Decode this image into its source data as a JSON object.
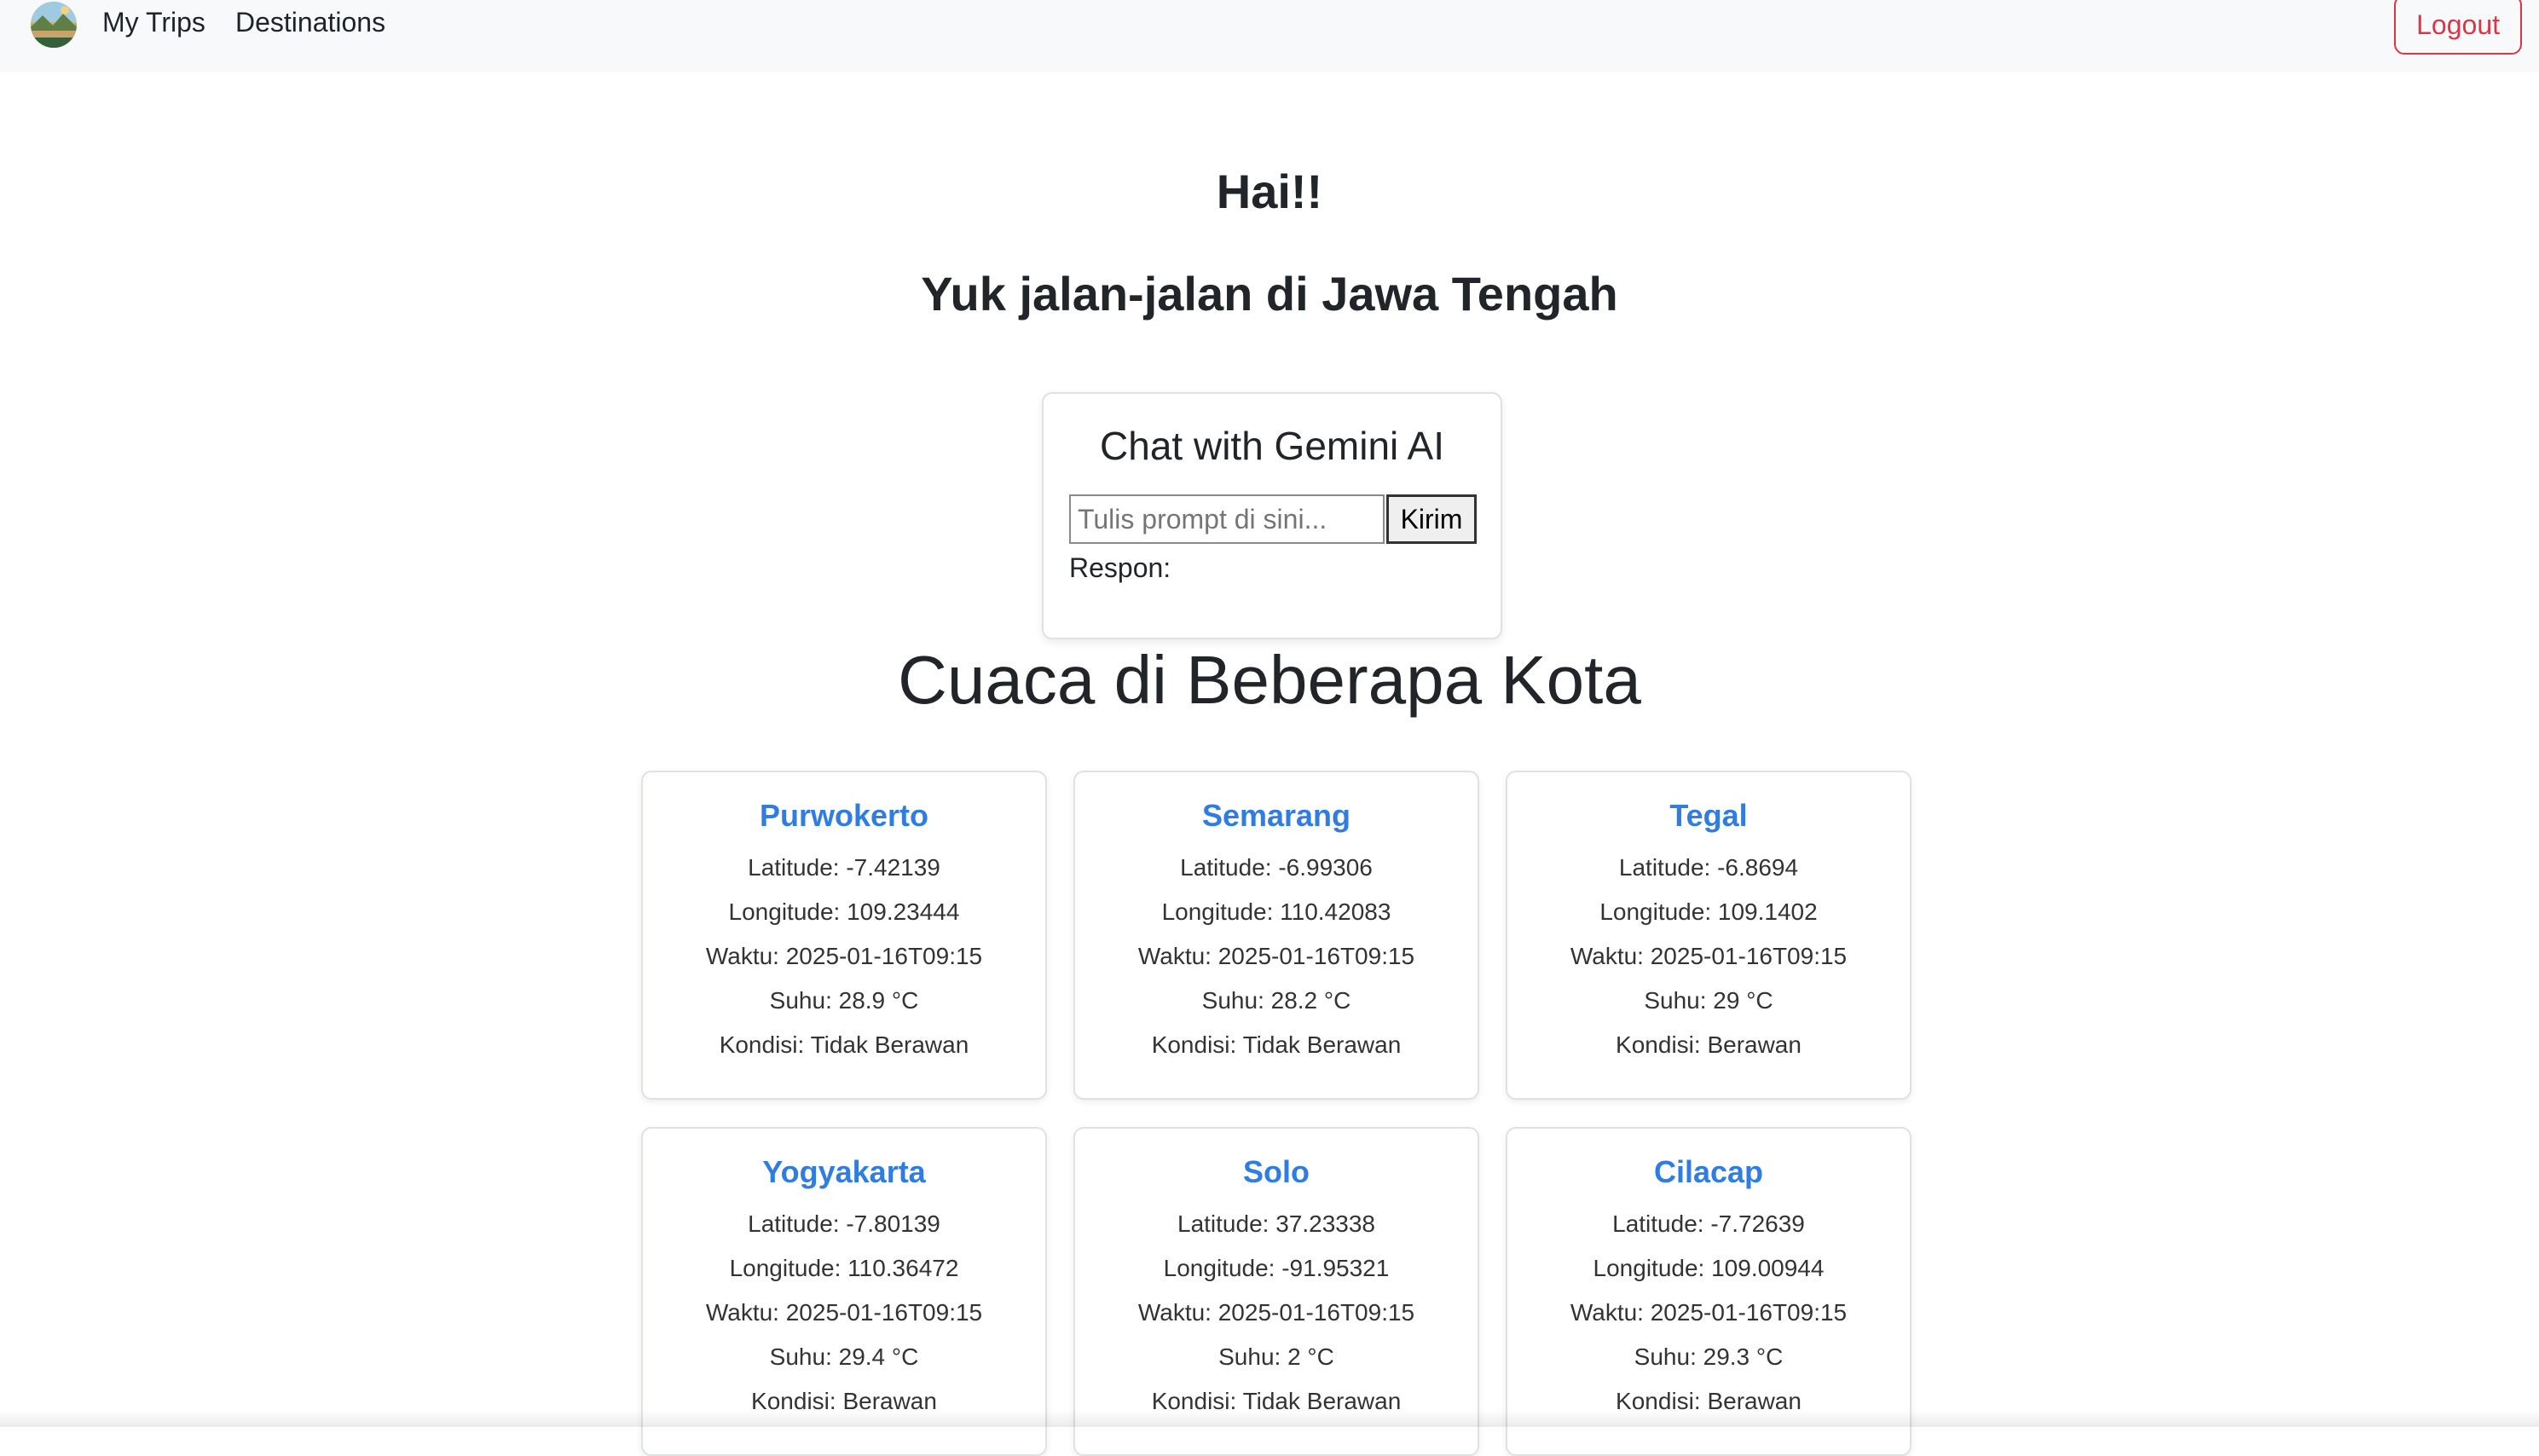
{
  "nav": {
    "logo_icon": "trip-logo-icon",
    "links": [
      {
        "label": "My Trips"
      },
      {
        "label": "Destinations"
      }
    ],
    "logout_label": "Logout"
  },
  "hero": {
    "greeting": "Hai!!",
    "subtitle": "Yuk jalan-jalan di Jawa Tengah"
  },
  "chat": {
    "title": "Chat with Gemini AI",
    "input_value": "",
    "input_placeholder": "Tulis prompt di sini...",
    "send_label": "Kirim",
    "response_label": "Respon:"
  },
  "weather": {
    "title": "Cuaca di Beberapa Kota",
    "cities": [
      {
        "name": "Purwokerto",
        "latitude": "Latitude: -7.42139",
        "longitude": "Longitude: 109.23444",
        "time": "Waktu: 2025-01-16T09:15",
        "temp": "Suhu: 28.9 °C",
        "condition": "Kondisi: Tidak Berawan"
      },
      {
        "name": "Semarang",
        "latitude": "Latitude: -6.99306",
        "longitude": "Longitude: 110.42083",
        "time": "Waktu: 2025-01-16T09:15",
        "temp": "Suhu: 28.2 °C",
        "condition": "Kondisi: Tidak Berawan"
      },
      {
        "name": "Tegal",
        "latitude": "Latitude: -6.8694",
        "longitude": "Longitude: 109.1402",
        "time": "Waktu: 2025-01-16T09:15",
        "temp": "Suhu: 29 °C",
        "condition": "Kondisi: Berawan"
      },
      {
        "name": "Yogyakarta",
        "latitude": "Latitude: -7.80139",
        "longitude": "Longitude: 110.36472",
        "time": "Waktu: 2025-01-16T09:15",
        "temp": "Suhu: 29.4 °C",
        "condition": "Kondisi: Berawan"
      },
      {
        "name": "Solo",
        "latitude": "Latitude: 37.23338",
        "longitude": "Longitude: -91.95321",
        "time": "Waktu: 2025-01-16T09:15",
        "temp": "Suhu: 2 °C",
        "condition": "Kondisi: Tidak Berawan"
      },
      {
        "name": "Cilacap",
        "latitude": "Latitude: -7.72639",
        "longitude": "Longitude: 109.00944",
        "time": "Waktu: 2025-01-16T09:15",
        "temp": "Suhu: 29.3 °C",
        "condition": "Kondisi: Berawan"
      }
    ]
  },
  "colors": {
    "accent": "#2f7de1",
    "danger": "#dc3545",
    "navbar": "#f8f9fa"
  }
}
